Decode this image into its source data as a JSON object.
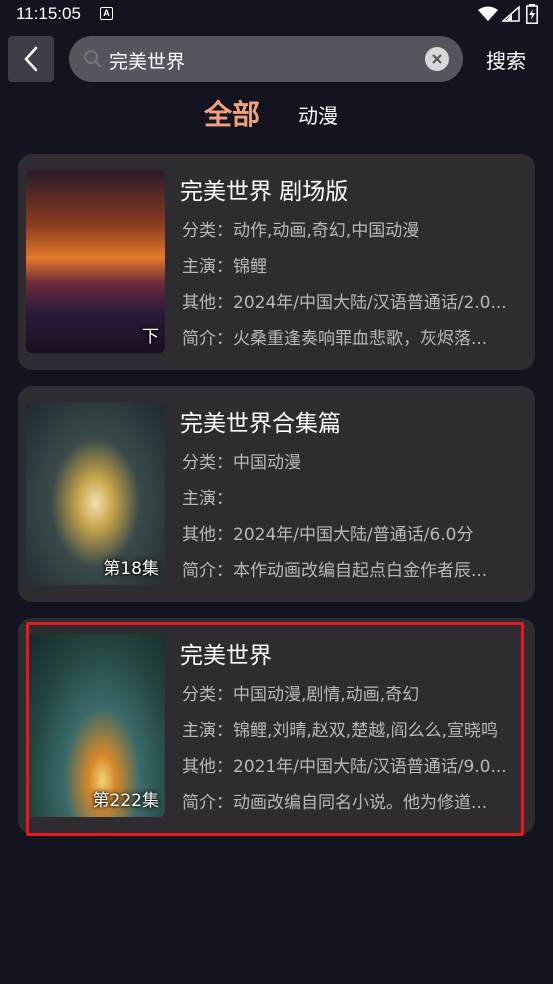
{
  "status_bar": {
    "time": "11:15:05",
    "a_label": "A"
  },
  "search": {
    "query": "完美世界",
    "button_label": "搜索"
  },
  "tabs": {
    "all": "全部",
    "anime": "动漫"
  },
  "colors": {
    "background": "#141420",
    "active_tab": "#f1a27a",
    "card": "#2e2c30",
    "highlight": "#e51a1a"
  },
  "results": [
    {
      "title": "完美世界 剧场版",
      "badge": "下",
      "category_label": "分类：",
      "category": "动作,动画,奇幻,中国动漫",
      "cast_label": "主演：",
      "cast": "锦鲤",
      "other_label": "其他：",
      "other": "2024年/中国大陆/汉语普通话/2.0...",
      "intro_label": "简介：",
      "intro": "火桑重逢奏响罪血悲歌，灰烬落..."
    },
    {
      "title": "完美世界合集篇",
      "badge": "第18集",
      "category_label": "分类：",
      "category": "中国动漫",
      "cast_label": "主演：",
      "cast": "",
      "other_label": "其他：",
      "other": "2024年/中国大陆/普通话/6.0分",
      "intro_label": "简介：",
      "intro": "本作动画改编自起点白金作者辰..."
    },
    {
      "title": "完美世界",
      "badge": "第222集",
      "category_label": "分类：",
      "category": "中国动漫,剧情,动画,奇幻",
      "cast_label": "主演：",
      "cast": "锦鲤,刘晴,赵双,楚越,阎么么,宣晓鸣",
      "other_label": "其他：",
      "other": "2021年/中国大陆/汉语普通话/9.0...",
      "intro_label": "简介：",
      "intro": "动画改编自同名小说。他为修道..."
    }
  ]
}
